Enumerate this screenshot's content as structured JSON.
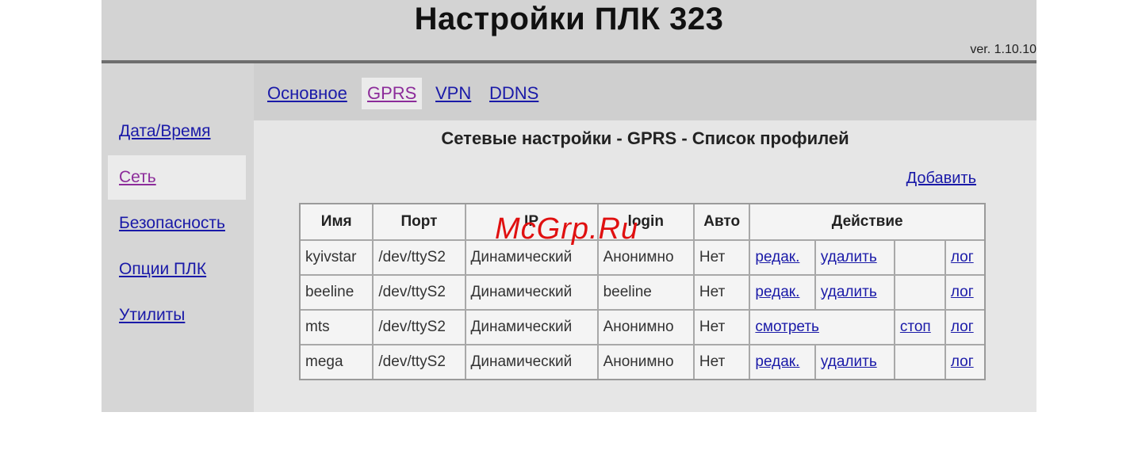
{
  "header": {
    "title": "Настройки ПЛК 323",
    "version": "ver. 1.10.10"
  },
  "sidebar": {
    "items": [
      {
        "label": "Дата/Время",
        "active": false
      },
      {
        "label": "Сеть",
        "active": true
      },
      {
        "label": "Безопасность",
        "active": false
      },
      {
        "label": "Опции ПЛК",
        "active": false
      },
      {
        "label": "Утилиты",
        "active": false
      }
    ]
  },
  "tabs": [
    {
      "label": "Основное",
      "active": false
    },
    {
      "label": "GPRS",
      "active": true
    },
    {
      "label": "VPN",
      "active": false
    },
    {
      "label": "DDNS",
      "active": false
    }
  ],
  "main": {
    "section_title": "Сетевые настройки - GPRS - Список профилей",
    "add_label": "Добавить"
  },
  "table": {
    "headers": [
      "Имя",
      "Порт",
      "IP",
      "login",
      "Авто",
      "Действие"
    ],
    "rows": [
      {
        "name": "kyivstar",
        "port": "/dev/ttyS2",
        "ip": "Динамический",
        "login": "Анонимно",
        "auto": "Нет",
        "edit": "редак.",
        "delete": "удалить",
        "log": "лог"
      },
      {
        "name": "beeline",
        "port": "/dev/ttyS2",
        "ip": "Динамический",
        "login": "beeline",
        "auto": "Нет",
        "edit": "редак.",
        "delete": "удалить",
        "log": "лог"
      },
      {
        "name": "mts",
        "port": "/dev/ttyS2",
        "ip": "Динамический",
        "login": "Анонимно",
        "auto": "Нет",
        "view": "смотреть",
        "stop": "стоп",
        "log": "лог"
      },
      {
        "name": "mega",
        "port": "/dev/ttyS2",
        "ip": "Динамический",
        "login": "Анонимно",
        "auto": "Нет",
        "edit": "редак.",
        "delete": "удалить",
        "log": "лог"
      }
    ]
  },
  "watermark": "McGrp.Ru",
  "colors": {
    "link": "#1a1aa8",
    "visited_link": "#8c2c9a",
    "watermark": "#e01010",
    "header_rule": "#6e6e6e"
  }
}
